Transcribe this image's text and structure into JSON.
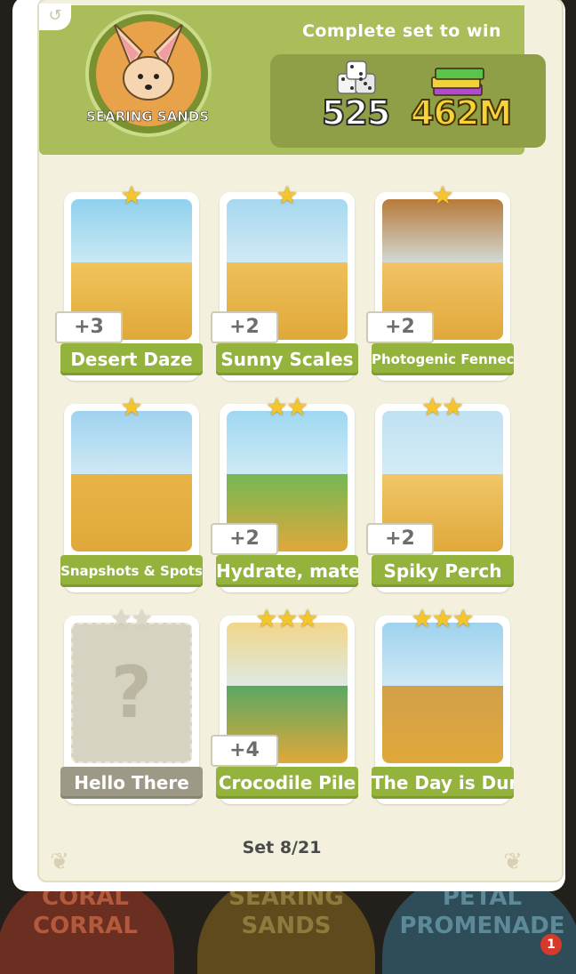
{
  "header": {
    "title": "Complete set to win",
    "set_name": "SEARING SANDS",
    "rewards": {
      "dice_count": "525",
      "cash_amount": "462M"
    }
  },
  "cards": [
    {
      "name": "Desert Daze",
      "stars": 1,
      "duplicates": "+3",
      "locked": false
    },
    {
      "name": "Sunny Scales",
      "stars": 1,
      "duplicates": "+2",
      "locked": false
    },
    {
      "name": "Photogenic Fennec",
      "stars": 1,
      "duplicates": "+2",
      "locked": false
    },
    {
      "name": "Snapshots & Spots",
      "stars": 1,
      "duplicates": "",
      "locked": false
    },
    {
      "name": "Hydrate, mate!",
      "stars": 2,
      "duplicates": "+2",
      "locked": false
    },
    {
      "name": "Spiky Perch",
      "stars": 2,
      "duplicates": "+2",
      "locked": false
    },
    {
      "name": "Hello There",
      "stars": 2,
      "duplicates": "",
      "locked": true
    },
    {
      "name": "Crocodile Pile",
      "stars": 3,
      "duplicates": "+4",
      "locked": false
    },
    {
      "name": "The Day is Dune",
      "stars": 3,
      "duplicates": "",
      "locked": false
    }
  ],
  "footer": {
    "set_counter": "Set 8/21"
  },
  "bottom_sets": {
    "left": "CORAL CORRAL",
    "middle": "SEARING SANDS",
    "right": "PETAL PROMENADE",
    "notification_count": "1"
  },
  "colors": {
    "accent_green": "#93b33c",
    "header_green": "#a9be5a",
    "panel_bg": "#f3f0de",
    "star_gold": "#f5c52b"
  }
}
